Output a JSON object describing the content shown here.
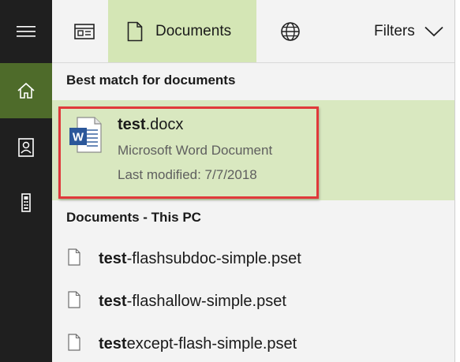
{
  "rail": {
    "items": [
      {
        "icon": "hamburger-menu-icon"
      },
      {
        "icon": "home-icon",
        "active": true
      },
      {
        "icon": "notebook-icon"
      },
      {
        "icon": "device-icon"
      }
    ],
    "active_color": "#4e6b2a"
  },
  "topbar": {
    "all_icon": "all-results-icon",
    "documents_label": "Documents",
    "web_icon": "globe-icon",
    "filters_label": "Filters"
  },
  "best_match": {
    "header": "Best match for documents",
    "title_bold": "test",
    "title_rest": ".docx",
    "type": "Microsoft Word Document",
    "modified": "Last modified: 7/7/2018",
    "icon": "word-document-icon",
    "highlight_color": "#e0393a"
  },
  "pc_results": {
    "header": "Documents - This PC",
    "items": [
      {
        "bold": "test",
        "rest": "-flashsubdoc-simple.pset"
      },
      {
        "bold": "test",
        "rest": "-flashallow-simple.pset"
      },
      {
        "bold": "test",
        "rest": "except-flash-simple.pset"
      }
    ]
  },
  "colors": {
    "selected_tab": "#d4e6b5",
    "best_match_bg": "#d9e8c0"
  }
}
